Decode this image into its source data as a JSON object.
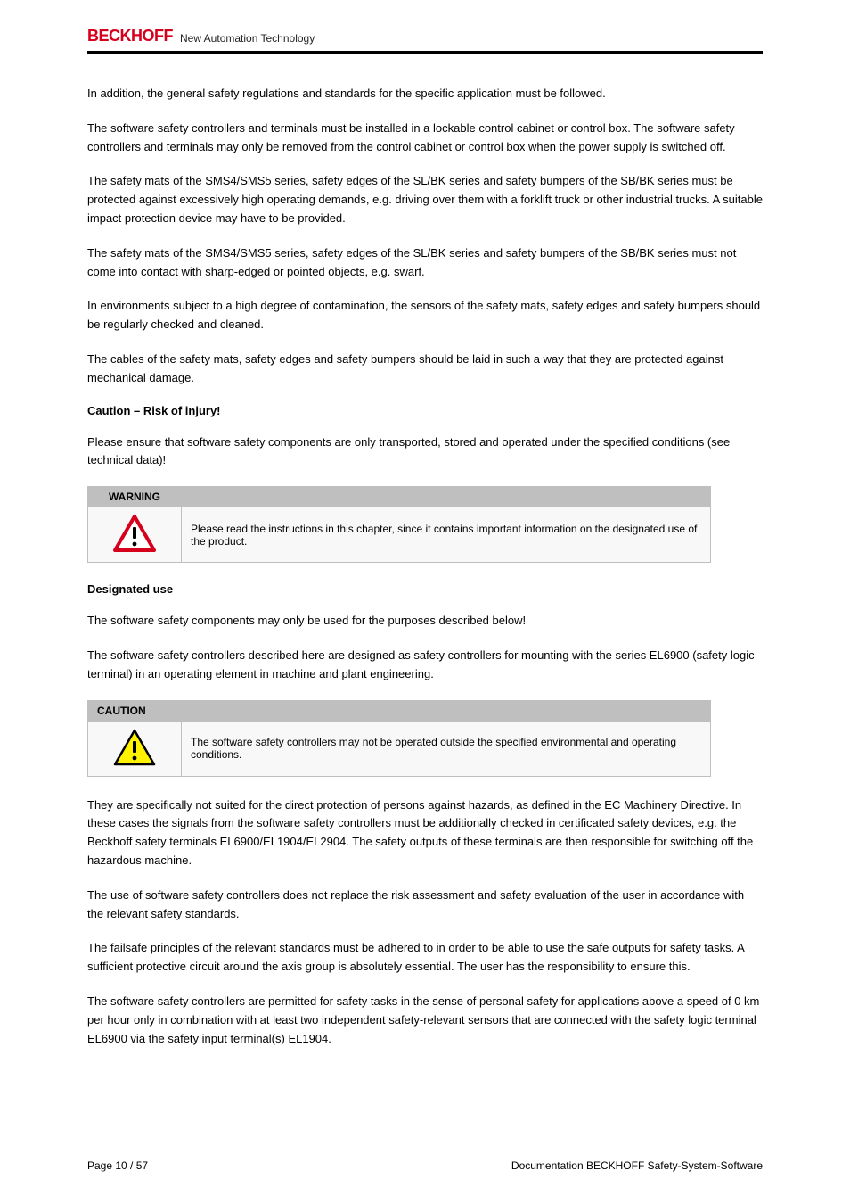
{
  "brand": {
    "name": "BECKHOFF",
    "tagline": "New Automation Technology"
  },
  "body": {
    "para1": "In addition, the general safety regulations and standards for the specific application must be followed.",
    "para2": "The software safety controllers and terminals must be installed in a lockable control cabinet or control box. The software safety controllers and terminals may only be removed from the control cabinet or control box when the power supply is switched off.",
    "para3": "The safety mats of the SMS4/SMS5 series, safety edges of the SL/BK series and safety bumpers of the SB/BK series must be protected against excessively high operating demands, e.g. driving over them with a forklift truck or other industrial trucks. A suitable impact protection device may have to be provided.",
    "para4": "The safety mats of the SMS4/SMS5 series, safety edges of the SL/BK series and safety bumpers of the SB/BK series must not come into contact with sharp-edged or pointed objects, e.g. swarf.",
    "para5": "In environments subject to a high degree of contamination, the sensors of the safety mats, safety edges and safety bumpers should be regularly checked and cleaned.",
    "para6": "The cables of the safety mats, safety edges and safety bumpers should be laid in such a way that they are protected against mechanical damage.",
    "heading_caution": "Caution – Risk of injury!",
    "para7": "Please ensure that software safety components are only transported, stored and operated under the specified conditions (see technical data)!",
    "table1": {
      "h_left": "WARNING",
      "h_right": "",
      "body_left_icon": "warning-red",
      "body_right": "Please read the instructions in this chapter, since it contains important information on the designated use of the product."
    },
    "heading_designated": "Designated use",
    "para8": "The software safety components may only be used for the purposes described below!",
    "para9": "The software safety controllers described here are designed as safety controllers for mounting with the series EL6900 (safety logic terminal) in an operating element in machine and plant engineering.",
    "table2": {
      "h_span": "CAUTION",
      "body_left_icon": "warning-yellow",
      "body_right": "The software safety controllers may not be operated outside the specified environmental and operating conditions."
    },
    "para10": "They are specifically not suited for the direct protection of persons against hazards, as defined in the EC Machinery Directive. In these cases the signals from the software safety controllers must be additionally checked in certificated safety devices, e.g. the Beckhoff safety terminals EL6900/EL1904/EL2904. The safety outputs of these terminals are then responsible for switching off the hazardous machine.",
    "para11": "The use of software safety controllers does not replace the risk assessment and safety evaluation of the user in accordance with the relevant safety standards.",
    "para12": "The failsafe principles of the relevant standards must be adhered to in order to be able to use the safe outputs for safety tasks. A sufficient protective circuit around the axis group is absolutely essential. The user has the responsibility to ensure this.",
    "para13": "The software safety controllers are permitted for safety tasks in the sense of personal safety for applications above a speed of 0 km per hour only in combination with at least two independent safety-relevant sensors that are connected with the safety logic terminal EL6900 via the safety input terminal(s) EL1904."
  },
  "footer": {
    "left": "Page 10 / 57",
    "right": "Documentation BECKHOFF Safety-System-Software"
  }
}
